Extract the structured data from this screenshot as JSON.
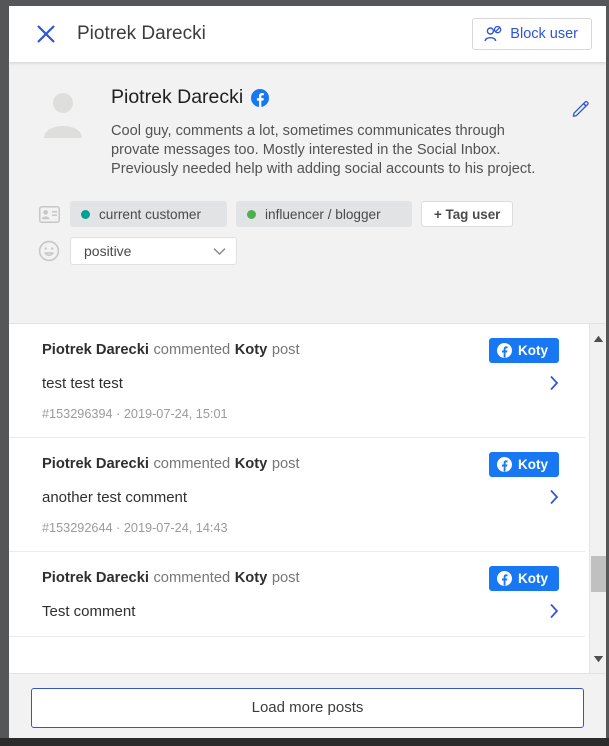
{
  "header": {
    "close_icon": "close-icon",
    "title": "Piotrek Darecki",
    "block_user_label": "Block user",
    "block_user_icon": "user-block-icon"
  },
  "profile": {
    "avatar_icon": "avatar-placeholder-icon",
    "name": "Piotrek Darecki",
    "network_icon": "facebook-icon",
    "description": "Cool guy, comments a lot, sometimes communicates through provate messages too. Mostly interested in the Social Inbox. Previously needed help with adding social accounts to his project.",
    "edit_icon": "pencil-icon",
    "tags_icon": "contact-card-icon",
    "sentiment_icon": "smiley-icon",
    "tags": [
      {
        "label": "current customer",
        "dot_color": "#00a094"
      },
      {
        "label": "influencer / blogger",
        "dot_color": "#4caf50"
      }
    ],
    "add_tag_label": "+ Tag user",
    "sentiment_value": "positive",
    "sentiment_chevron_icon": "chevron-down-icon"
  },
  "posts": [
    {
      "author": "Piotrek Darecki",
      "action": "commented",
      "target": "Koty",
      "suffix": "post",
      "badge_label": "Koty",
      "badge_icon": "facebook-icon",
      "text": "test test test",
      "id": "#153296394",
      "separator": "·",
      "timestamp": "2019-07-24, 15:01",
      "chevron_icon": "chevron-right-icon"
    },
    {
      "author": "Piotrek Darecki",
      "action": "commented",
      "target": "Koty",
      "suffix": "post",
      "badge_label": "Koty",
      "badge_icon": "facebook-icon",
      "text": "another test comment",
      "id": "#153292644",
      "separator": "·",
      "timestamp": "2019-07-24, 14:43",
      "chevron_icon": "chevron-right-icon"
    },
    {
      "author": "Piotrek Darecki",
      "action": "commented",
      "target": "Koty",
      "suffix": "post",
      "badge_label": "Koty",
      "badge_icon": "facebook-icon",
      "text": "Test comment",
      "id": "",
      "separator": "",
      "timestamp": "",
      "chevron_icon": "chevron-right-icon"
    }
  ],
  "scrollbar": {
    "up_icon": "triangle-up-icon",
    "down_icon": "triangle-down-icon",
    "thumb": "scrollbar-thumb"
  },
  "footer": {
    "load_more_label": "Load more posts"
  },
  "colors": {
    "accent_blue": "#2f55d4",
    "facebook_blue": "#1877f2",
    "panel_gray": "#f2f2f2"
  }
}
